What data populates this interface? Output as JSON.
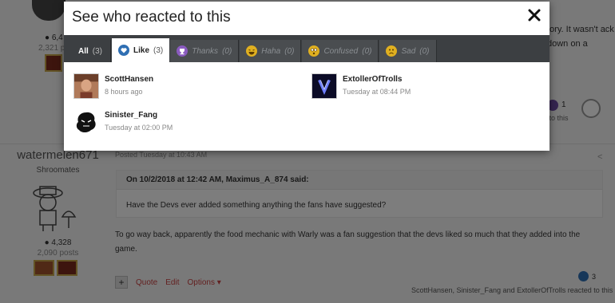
{
  "background": {
    "top_text": "tory. It wasn't ack down on a",
    "top_user_rep": "6,4",
    "top_user_posts": "2,321 p",
    "top_like_count": "1",
    "top_like_to": "d to this",
    "post_username": "watermelen671",
    "post_user_role": "Shroomates",
    "post_user_rep": "4,328",
    "post_user_posts": "2,090 posts",
    "post_meta": "Posted Tuesday at 10:43 AM",
    "quote_author": "On 10/2/2018 at 12:42 AM, Maximus_A_874 said:",
    "quote_text": "Have the Devs ever added something anything the fans have suggested?",
    "body_text": "To go way back, apparently the food mechanic with Warly was a fan suggestion that the devs liked so much that they added into the game.",
    "actions": {
      "plus": "+",
      "quote": "Quote",
      "edit": "Edit",
      "options": "Options"
    },
    "reaction_count": "3",
    "reacted_line": "ScottHansen, Sinister_Fang and ExtollerOfTrolls reacted to this"
  },
  "modal": {
    "title": "See who reacted to this",
    "close_icon": "close-icon",
    "tabs": [
      {
        "label": "All",
        "count": "(3)",
        "icon": null
      },
      {
        "label": "Like",
        "count": "(3)",
        "icon": "like-icon",
        "color": "#2f6fb3"
      },
      {
        "label": "Thanks",
        "count": "(0)",
        "icon": "thanks-icon",
        "color": "#8a5bbf"
      },
      {
        "label": "Haha",
        "count": "(0)",
        "icon": "haha-icon",
        "color": "#e0b020"
      },
      {
        "label": "Confused",
        "count": "(0)",
        "icon": "confused-icon",
        "color": "#e0b020"
      },
      {
        "label": "Sad",
        "count": "(0)",
        "icon": "sad-icon",
        "color": "#e0b020"
      }
    ],
    "reactors": [
      {
        "name": "ScottHansen",
        "time": "8 hours ago"
      },
      {
        "name": "ExtollerOfTrolls",
        "time": "Tuesday at 08:44 PM"
      },
      {
        "name": "Sinister_Fang",
        "time": "Tuesday at 02:00 PM"
      }
    ]
  }
}
